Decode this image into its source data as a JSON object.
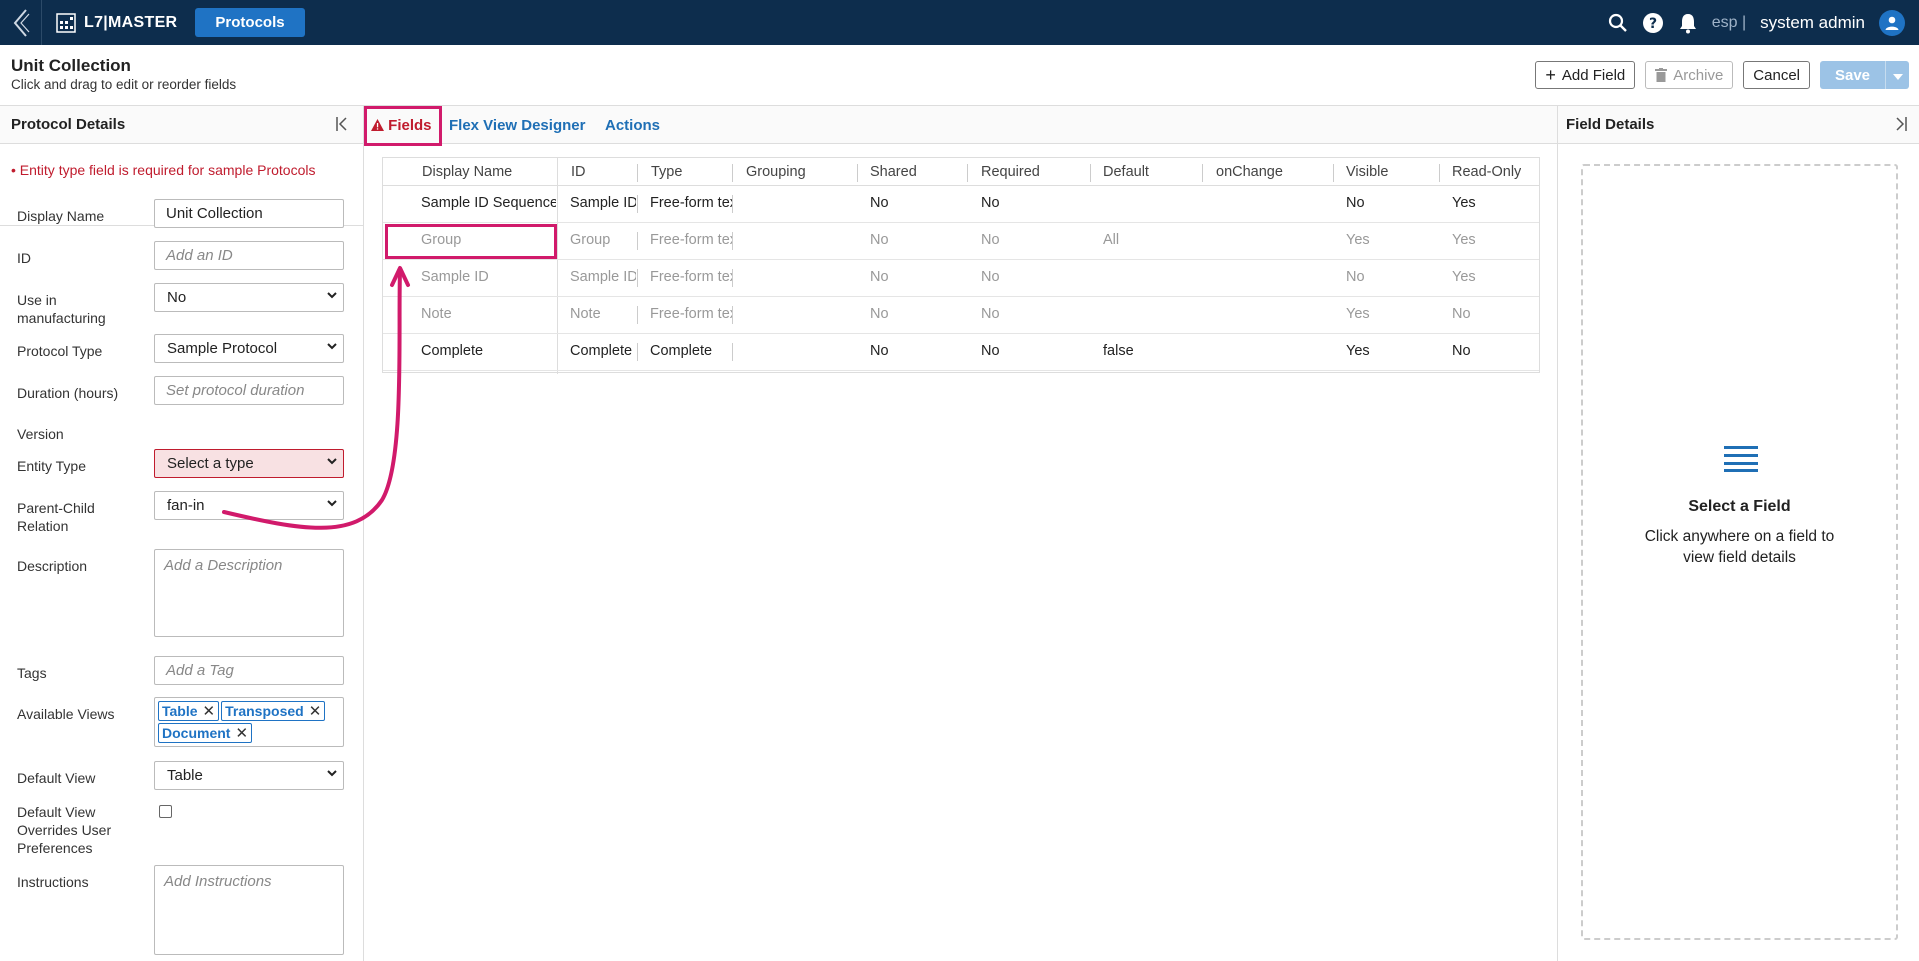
{
  "nav": {
    "app_name": "L7|MASTER",
    "active_button": "Protocols",
    "lang": "esp |",
    "user": "system admin"
  },
  "header": {
    "title": "Unit Collection",
    "subtitle": "Click and drag to edit or reorder fields",
    "add_field": "Add Field",
    "archive": "Archive",
    "cancel": "Cancel",
    "save": "Save"
  },
  "left_panel": {
    "title": "Protocol Details",
    "error": "• Entity type field is required for sample Protocols",
    "fields": {
      "display_name": {
        "label": "Display Name",
        "value": "Unit Collection"
      },
      "id": {
        "label": "ID",
        "placeholder": "Add an ID"
      },
      "use_in_manufacturing": {
        "label": "Use in manufacturing",
        "value": "No"
      },
      "protocol_type": {
        "label": "Protocol Type",
        "value": "Sample Protocol"
      },
      "duration": {
        "label": "Duration (hours)",
        "placeholder": "Set protocol duration"
      },
      "version": {
        "label": "Version"
      },
      "entity_type": {
        "label": "Entity Type",
        "value": "Select a type"
      },
      "parent_child": {
        "label": "Parent-Child Relation",
        "value": "fan-in"
      },
      "description": {
        "label": "Description",
        "placeholder": "Add a Description"
      },
      "tags": {
        "label": "Tags",
        "placeholder": "Add a Tag"
      },
      "available_views": {
        "label": "Available Views",
        "tags": [
          "Table",
          "Transposed",
          "Document"
        ]
      },
      "default_view": {
        "label": "Default View",
        "value": "Table"
      },
      "default_view_overrides": {
        "label": "Default View Overrides User Preferences"
      },
      "instructions": {
        "label": "Instructions",
        "placeholder": "Add Instructions"
      }
    }
  },
  "tabs": [
    "Fields",
    "Flex View Designer",
    "Actions"
  ],
  "grid": {
    "columns": [
      "Display Name",
      "ID",
      "Type",
      "Grouping",
      "Shared",
      "Required",
      "Default",
      "onChange",
      "Visible",
      "Read-Only"
    ],
    "rows": [
      {
        "dim": false,
        "cells": [
          "Sample ID Sequence",
          "Sample ID",
          "Free-form tex",
          "",
          "No",
          "No",
          "",
          "",
          "No",
          "Yes"
        ]
      },
      {
        "dim": true,
        "cells": [
          "Group",
          "Group",
          "Free-form tex",
          "",
          "No",
          "No",
          "All",
          "",
          "Yes",
          "Yes"
        ]
      },
      {
        "dim": true,
        "cells": [
          "Sample ID",
          "Sample ID",
          "Free-form tex",
          "",
          "No",
          "No",
          "",
          "",
          "No",
          "Yes"
        ]
      },
      {
        "dim": true,
        "cells": [
          "Note",
          "Note",
          "Free-form tex",
          "",
          "No",
          "No",
          "",
          "",
          "Yes",
          "No"
        ]
      },
      {
        "dim": false,
        "cells": [
          "Complete",
          "Complete",
          "Complete",
          "",
          "No",
          "No",
          "false",
          "",
          "Yes",
          "No"
        ]
      }
    ]
  },
  "right_panel": {
    "title": "Field Details",
    "empty_title": "Select a Field",
    "empty_text": "Click anywhere on a field to view field details"
  },
  "colors": {
    "nav_bg": "#0d2d4d",
    "accent": "#1f73c4",
    "error": "#c01c2e",
    "highlight": "#d11a6b"
  }
}
